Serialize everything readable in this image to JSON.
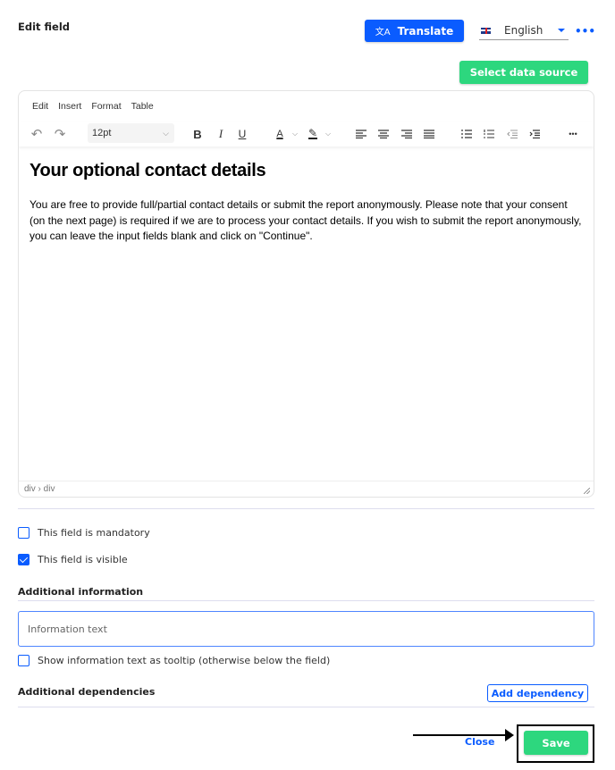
{
  "header": {
    "title": "Edit field",
    "translate_label": "Translate",
    "translate_icon": "translate-icon",
    "language": "English",
    "language_flag": "uk-flag-icon",
    "more_icon": "more-horizontal-icon",
    "select_data_source_label": "Select data source"
  },
  "editor": {
    "menu": [
      "Edit",
      "Insert",
      "Format",
      "Table"
    ],
    "toolbar": {
      "font_size": "12pt",
      "bold": "B",
      "italic": "I",
      "underline": "U",
      "text_color": "A",
      "more": "•••"
    },
    "content": {
      "heading": "Your optional contact details",
      "paragraph": "You are free to provide full/partial contact details or submit the report anonymously. Please note that your consent (on the next page) is required if we are to process your contact details. If you wish to submit the report anonymously, you can leave the input fields blank and click on \"Continue\"."
    },
    "statusbar_path": "div › div"
  },
  "options": {
    "mandatory": {
      "label": "This field is mandatory",
      "checked": false
    },
    "visible": {
      "label": "This field is visible",
      "checked": true
    }
  },
  "additional_information": {
    "title": "Additional information",
    "input_placeholder": "Information text",
    "input_value": "",
    "tooltip_checkbox": {
      "label": "Show information text as tooltip (otherwise below the field)",
      "checked": false
    }
  },
  "additional_dependencies": {
    "title": "Additional dependencies",
    "add_label": "Add dependency"
  },
  "footer": {
    "close_label": "Close",
    "save_label": "Save"
  },
  "colors": {
    "primary": "#0a5cff",
    "success": "#2dd77e"
  }
}
